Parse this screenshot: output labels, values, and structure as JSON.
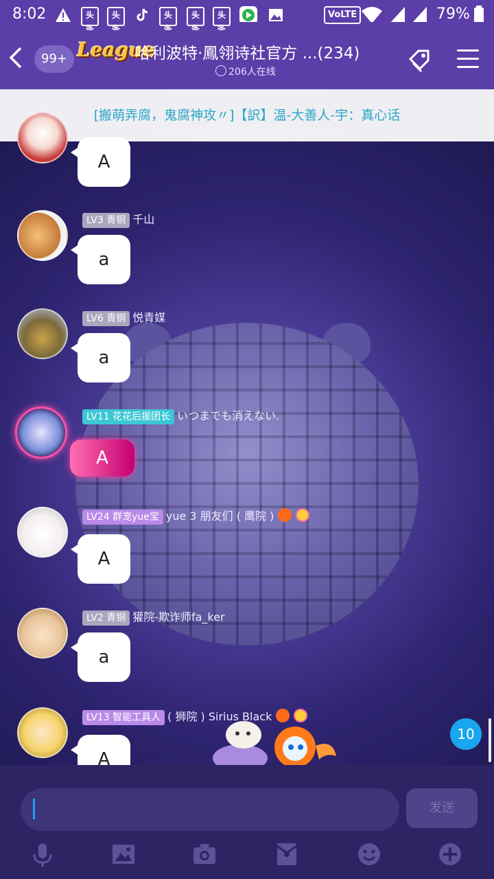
{
  "status_bar": {
    "time": "8:02",
    "app_labels": [
      "头条",
      "头条",
      "头条",
      "头条",
      "头条"
    ],
    "volte": "VoLTE",
    "battery": "79%"
  },
  "header": {
    "badge": "99+",
    "logo": "League",
    "title": "哈利波特·鳳翎诗社官方 ...(234)",
    "online": "206人在线"
  },
  "announcement": "[搬萌弄腐，鬼腐神攻〃]【訳】温-大善人-宇：真心话",
  "messages": [
    {
      "level": "",
      "name": "",
      "text": "A"
    },
    {
      "level": "LV3 青铜",
      "name": "千山",
      "text": "a"
    },
    {
      "level": "LV6 青铜",
      "name": "悦青媒",
      "text": "a"
    },
    {
      "level": "LV11 花花后援团长",
      "name": "いつまでも消えない.",
      "text": "A"
    },
    {
      "level": "LV24 群宠yue宝",
      "name": "yue 3 朋友们 ( 鹰院 )",
      "text": "A"
    },
    {
      "level": "LV2 青铜",
      "name": "獾院-欺诈师fa_ker",
      "text": "a"
    },
    {
      "level": "LV13 智能工具人",
      "name": "( 狮院 ) Sirius Black",
      "text": "A"
    }
  ],
  "unread_count": "10",
  "input": {
    "placeholder": "",
    "send_label": "发送"
  },
  "colors": {
    "header": "#5b3ea8",
    "accent": "#19a6ee",
    "announce_text": "#2aa6c7"
  }
}
